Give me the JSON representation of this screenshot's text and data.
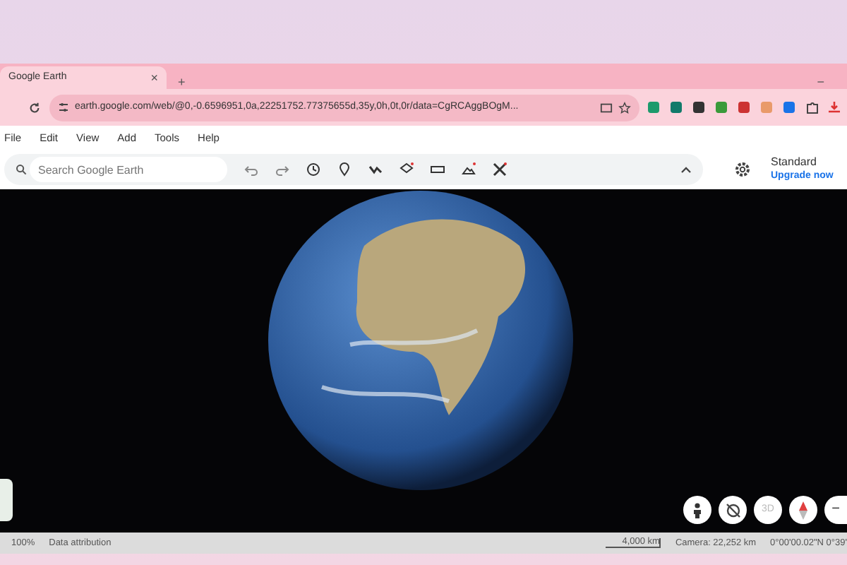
{
  "browser": {
    "tab": {
      "title": "Google Earth",
      "close": "×"
    },
    "new_tab": "+",
    "url": "earth.google.com/web/@0,-0.6596951,0a,22251752.77375655d,35y,0h,0t,0r/data=CgRCAggBOgM...",
    "window_control": "−"
  },
  "menu": [
    "File",
    "Edit",
    "View",
    "Add",
    "Tools",
    "Help"
  ],
  "toolbar": {
    "search": {
      "placeholder": "Search Google Earth"
    },
    "plan": "Standard",
    "upgrade": "Upgrade now"
  },
  "map_controls": {
    "view_mode": "3D",
    "zoom_out": "−"
  },
  "status_bar": {
    "zoom": "100%",
    "attribution": "Data attribution",
    "scale": "4,000 km",
    "camera": "Camera: 22,252 km",
    "coordinates": "0°00'00.02\"N 0°39'"
  }
}
